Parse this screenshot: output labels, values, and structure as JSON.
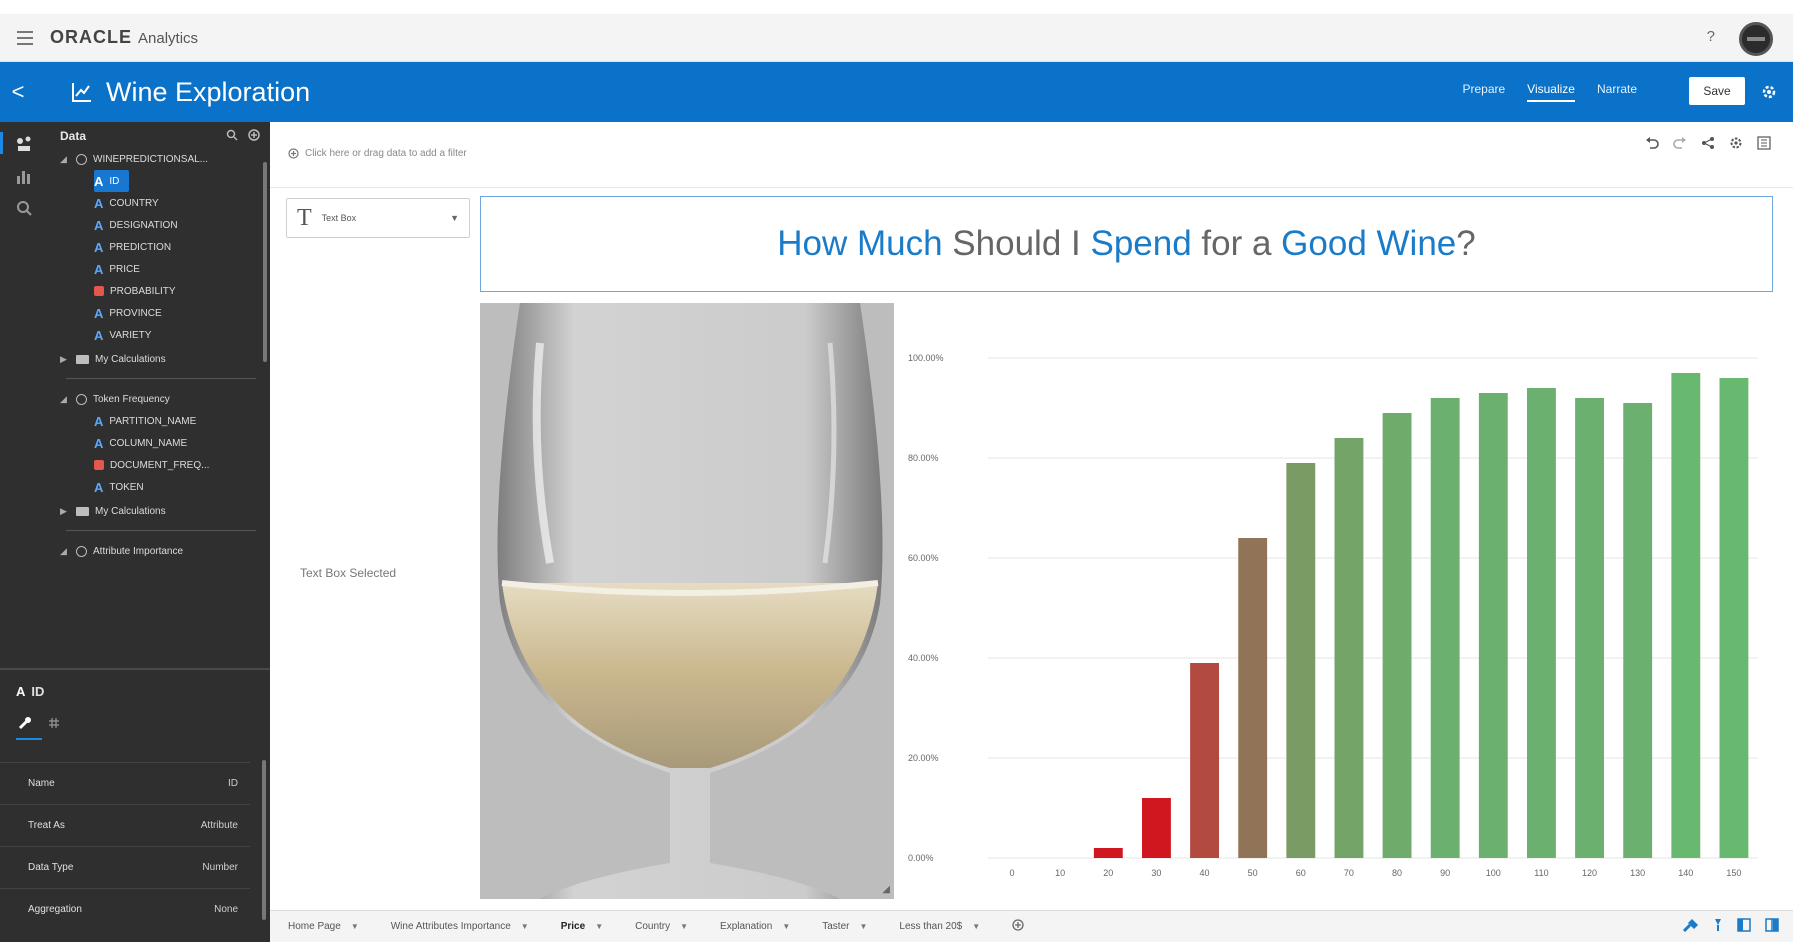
{
  "app": {
    "brand_oracle": "ORACLE",
    "brand_analytics": "Analytics",
    "help_label": "?"
  },
  "header": {
    "back_label": "<",
    "title": "Wine Exploration",
    "tabs": [
      {
        "label": "Prepare",
        "active": false
      },
      {
        "label": "Visualize",
        "active": true
      },
      {
        "label": "Narrate",
        "active": false
      }
    ],
    "save_label": "Save"
  },
  "datapanel": {
    "title": "Data",
    "tree": [
      {
        "label": "WINEPREDICTIONSAL...",
        "kind": "dataset",
        "indent": 0
      },
      {
        "label": "ID",
        "kind": "attribute",
        "indent": 1,
        "selected": true
      },
      {
        "label": "COUNTRY",
        "kind": "attribute",
        "indent": 1
      },
      {
        "label": "DESIGNATION",
        "kind": "attribute",
        "indent": 1
      },
      {
        "label": "PREDICTION",
        "kind": "attribute",
        "indent": 1
      },
      {
        "label": "PRICE",
        "kind": "attribute",
        "indent": 1
      },
      {
        "label": "PROBABILITY",
        "kind": "measure",
        "indent": 1
      },
      {
        "label": "PROVINCE",
        "kind": "attribute",
        "indent": 1
      },
      {
        "label": "VARIETY",
        "kind": "attribute",
        "indent": 1
      },
      {
        "label": "My Calculations",
        "kind": "folder",
        "indent": 0
      },
      {
        "label": "Token Frequency",
        "kind": "dataset",
        "indent": 0
      },
      {
        "label": "PARTITION_NAME",
        "kind": "attribute",
        "indent": 1
      },
      {
        "label": "COLUMN_NAME",
        "kind": "attribute",
        "indent": 1
      },
      {
        "label": "DOCUMENT_FREQ...",
        "kind": "measure",
        "indent": 1
      },
      {
        "label": "TOKEN",
        "kind": "attribute",
        "indent": 1
      },
      {
        "label": "My Calculations",
        "kind": "folder",
        "indent": 0
      },
      {
        "label": "Attribute Importance",
        "kind": "dataset",
        "indent": 0
      }
    ]
  },
  "properties": {
    "element_name": "ID",
    "rows": [
      {
        "label": "Name",
        "value": "ID"
      },
      {
        "label": "Treat As",
        "value": "Attribute"
      },
      {
        "label": "Data Type",
        "value": "Number"
      },
      {
        "label": "Aggregation",
        "value": "None"
      }
    ]
  },
  "canvas": {
    "filter_placeholder": "Click here or drag data to add a filter",
    "textbox_picker_label": "Text Box",
    "textbox_selected": "Text Box Selected",
    "headline": {
      "w1": "How Much",
      "w2": " Should I ",
      "w3": "Spend",
      "w4": " for a ",
      "w5": "Good Wine",
      "w6": "?"
    }
  },
  "chart_data": {
    "type": "bar",
    "categories": [
      "0",
      "10",
      "20",
      "30",
      "40",
      "50",
      "60",
      "70",
      "80",
      "90",
      "100",
      "110",
      "120",
      "130",
      "140",
      "150"
    ],
    "values": [
      0,
      0,
      2,
      12,
      39,
      64,
      79,
      84,
      89,
      92,
      93,
      94,
      92,
      91,
      97,
      96
    ],
    "colors": [
      "#d0161f",
      "#d0161f",
      "#d0161f",
      "#d0161f",
      "#b34a40",
      "#917357",
      "#7b9b65",
      "#75a469",
      "#6fac6c",
      "#6bb06f",
      "#6bb06f",
      "#6bb06f",
      "#6bb06f",
      "#6bb06f",
      "#69b86f",
      "#69b86f"
    ],
    "yticks": [
      "0.00%",
      "20.00%",
      "40.00%",
      "60.00%",
      "80.00%",
      "100.00%"
    ],
    "ylim": [
      0,
      100
    ],
    "grid": true
  },
  "bottom_tabs": [
    {
      "label": "Home Page",
      "active": false
    },
    {
      "label": "Wine Attributes Importance",
      "active": false
    },
    {
      "label": "Price",
      "active": true
    },
    {
      "label": "Country",
      "active": false
    },
    {
      "label": "Explanation",
      "active": false
    },
    {
      "label": "Taster",
      "active": false
    },
    {
      "label": "Less than 20$",
      "active": false
    }
  ]
}
